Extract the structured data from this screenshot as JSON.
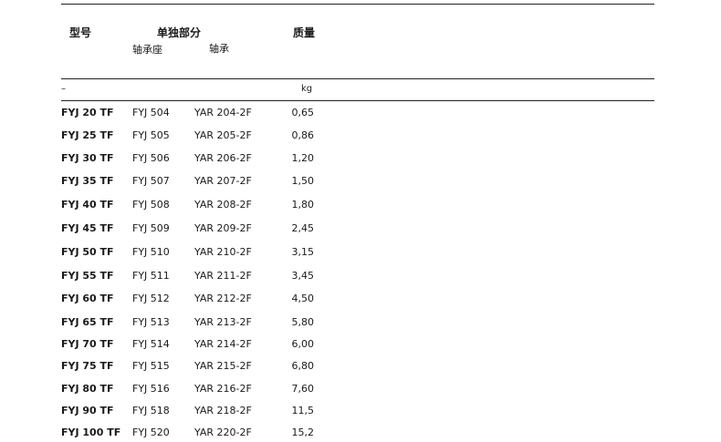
{
  "headers": {
    "model": "型号",
    "parts": "单独部分",
    "housing": "轴承座",
    "bearing": "轴承",
    "mass": "质量"
  },
  "units": {
    "model": "–",
    "mass": "kg"
  },
  "rows": [
    {
      "model": "FYJ 20 TF",
      "housing": "FYJ 504",
      "bearing": "YAR 204-2F",
      "mass": "0,65"
    },
    {
      "model": "FYJ 25 TF",
      "housing": "FYJ 505",
      "bearing": "YAR 205-2F",
      "mass": "0,86"
    },
    {
      "model": "FYJ 30 TF",
      "housing": "FYJ 506",
      "bearing": "YAR 206-2F",
      "mass": "1,20"
    },
    {
      "model": "FYJ 35 TF",
      "housing": "FYJ 507",
      "bearing": "YAR 207-2F",
      "mass": "1,50"
    },
    {
      "model": "FYJ 40 TF",
      "housing": "FYJ 508",
      "bearing": "YAR 208-2F",
      "mass": "1,80"
    },
    {
      "model": "FYJ 45 TF",
      "housing": "FYJ 509",
      "bearing": "YAR 209-2F",
      "mass": "2,45"
    },
    {
      "model": "FYJ 50 TF",
      "housing": "FYJ 510",
      "bearing": "YAR 210-2F",
      "mass": "3,15"
    },
    {
      "model": "FYJ 55 TF",
      "housing": "FYJ 511",
      "bearing": "YAR 211-2F",
      "mass": "3,45"
    },
    {
      "model": "FYJ 60 TF",
      "housing": "FYJ 512",
      "bearing": "YAR 212-2F",
      "mass": "4,50"
    },
    {
      "model": "FYJ 65 TF",
      "housing": "FYJ 513",
      "bearing": "YAR 213-2F",
      "mass": "5,80"
    },
    {
      "model": "FYJ 70 TF",
      "housing": "FYJ 514",
      "bearing": "YAR 214-2F",
      "mass": "6,00"
    },
    {
      "model": "FYJ 75 TF",
      "housing": "FYJ 515",
      "bearing": "YAR 215-2F",
      "mass": "6,80"
    },
    {
      "model": "FYJ 80 TF",
      "housing": "FYJ 516",
      "bearing": "YAR 216-2F",
      "mass": "7,60"
    },
    {
      "model": "FYJ 90 TF",
      "housing": "FYJ 518",
      "bearing": "YAR 218-2F",
      "mass": "11,5"
    },
    {
      "model": "FYJ 100 TF",
      "housing": "FYJ 520",
      "bearing": "YAR 220-2F",
      "mass": "15,2"
    }
  ]
}
